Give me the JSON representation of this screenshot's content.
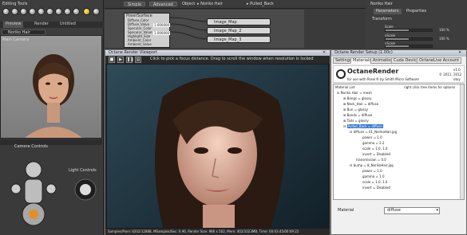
{
  "left_panel": {
    "title": "Editing Tools",
    "tabs": [
      "Preview",
      "Render",
      "Untitled"
    ],
    "figure_select": "Noriko Hair",
    "camera_label": "Main Camera",
    "camera_controls": "Camera Controls",
    "light_controls": "Light Controls"
  },
  "top_bar": {
    "simple": "Simple",
    "advanced": "Advanced",
    "object_label": "Object",
    "object_value": "Noriko Hair",
    "material_value": "Pulled_Back"
  },
  "shader": {
    "node_title": "PoserSurface",
    "rows": [
      "Diffuse_Color",
      "Diffuse_Value",
      "Specular_Color",
      "Specular_Value",
      "Highlight_Size",
      "Ambient_Color",
      "Ambient_Value"
    ],
    "value_1": "1.000000",
    "value_2": "1.000000",
    "image_nodes": [
      "Image_Map",
      "Image_Map_2",
      "Image_Map_3"
    ]
  },
  "right_top": {
    "title": "Noriko Hair",
    "tabs": [
      "Parameters",
      "Properties"
    ],
    "section": "Transform",
    "sliders": [
      {
        "label": "Scale",
        "value": "100 %",
        "fill": 0.5
      },
      {
        "label": "xScale",
        "value": "100 %",
        "fill": 0.5
      },
      {
        "label": "yScale",
        "value": "100 %",
        "fill": 0.5
      }
    ]
  },
  "render_viewport": {
    "title": "Octane Render Viewport",
    "hint": "Click to pick a focus distance.  Drag to scroll the window when resolution is locked",
    "status": "Samples/Pixel: 8202/12888, MSamples/Sec: 0.96, Render Size: 986 x 502, Mem: 402/1023MB, Time: 00:03:45/00:09:22"
  },
  "octane_window": {
    "title": "Octane Render Setup (1.00c)",
    "tabs": [
      "Settings",
      "Materials",
      "Animation",
      "Cuda Devices",
      "OctaneLive Account"
    ],
    "brand": "OctaneRender",
    "brand_sub": "for use with Poser® by Smith Micro Software",
    "version": "v1.0",
    "copyright": "© 2011, 2012",
    "company": "otoy",
    "list_header": "Material List",
    "list_hint": "right click tree items for options",
    "tree": [
      "Noriko Hair = mesh",
      "Bangs = glossy",
      "Neck_Hair = diffuse",
      "Bun = glossy",
      "Bands = diffuse",
      "Tails = glossy",
      "Pulled_Back = diffuse",
      "diffuse = 01_NorikoHair.jpg",
      "power = 1.0",
      "gamma = 2.2",
      "scale = 1.0, 1.0",
      "invert = Disabled",
      "transmission = 0.0",
      "bump = 8_NorikoHair.jpg",
      "power = 1.0",
      "gamma = 1.0",
      "scale = 1.0, 1.0",
      "invert = Disabled"
    ],
    "material_label": "Material",
    "material_value": "diffuse"
  }
}
